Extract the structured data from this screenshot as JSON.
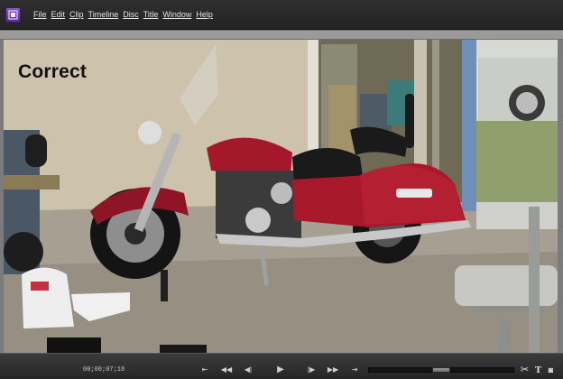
{
  "app": {
    "icon": "film-app-icon",
    "brand_color": "#6b3aa8"
  },
  "menu": {
    "items": [
      {
        "label": "File"
      },
      {
        "label": "Edit"
      },
      {
        "label": "Clip"
      },
      {
        "label": "Timeline"
      },
      {
        "label": "Disc"
      },
      {
        "label": "Title"
      },
      {
        "label": "Window"
      },
      {
        "label": "Help"
      }
    ]
  },
  "monitor": {
    "title_text": "Correct"
  },
  "transport": {
    "timecode": "00;00;07;18",
    "buttons": [
      {
        "icon": "go-to-in-point-icon",
        "glyph": "⇤"
      },
      {
        "icon": "rewind-icon",
        "glyph": "◀◀"
      },
      {
        "icon": "step-back-icon",
        "glyph": "◀|"
      },
      {
        "icon": "play-icon",
        "glyph": "▶"
      },
      {
        "icon": "step-forward-icon",
        "glyph": "|▶"
      },
      {
        "icon": "fast-forward-icon",
        "glyph": "▶▶"
      },
      {
        "icon": "go-to-out-point-icon",
        "glyph": "⇥"
      }
    ],
    "tools": [
      {
        "icon": "scissors-icon",
        "glyph": "✂"
      },
      {
        "icon": "title-tool-icon",
        "glyph": "T"
      },
      {
        "icon": "camera-snapshot-icon",
        "glyph": "◙"
      }
    ]
  }
}
